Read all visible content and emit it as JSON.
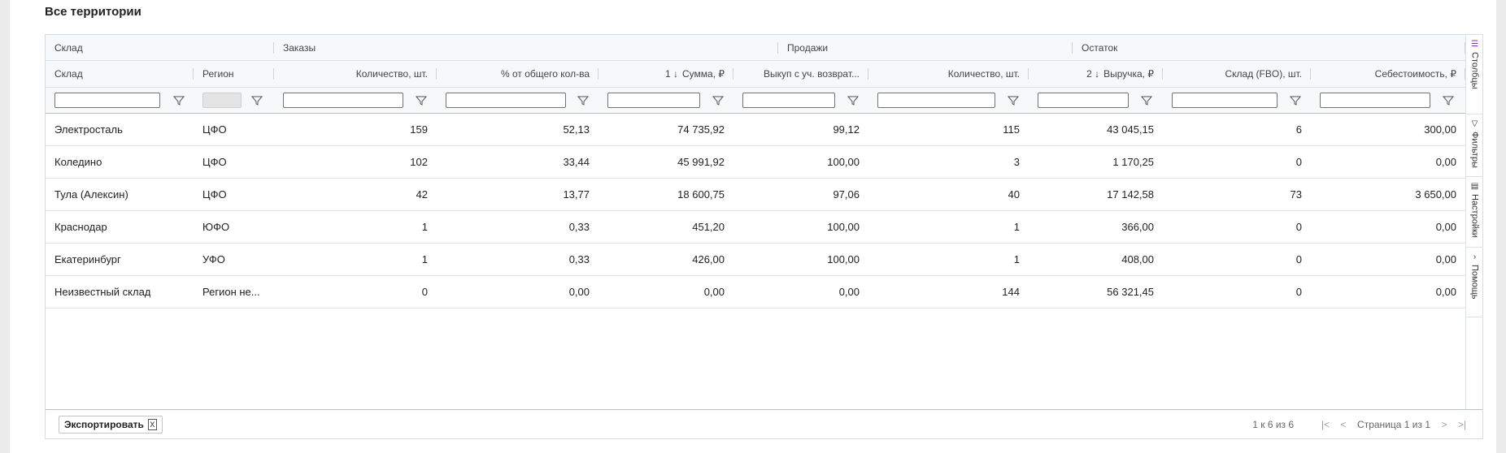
{
  "section": {
    "title": "Все территории"
  },
  "groups": [
    {
      "label": "Склад"
    },
    {
      "label": "Заказы"
    },
    {
      "label": "Продажи"
    },
    {
      "label": "Остаток"
    }
  ],
  "columns": [
    {
      "label": "Склад",
      "sort": ""
    },
    {
      "label": "Регион",
      "sort": ""
    },
    {
      "label": "Количество, шт.",
      "sort": ""
    },
    {
      "label": "% от общего кол-ва",
      "sort": ""
    },
    {
      "label": "Сумма, ₽",
      "sort": "1 ↓"
    },
    {
      "label": "Выкуп с уч. возврат...",
      "sort": ""
    },
    {
      "label": "Количество, шт.",
      "sort": ""
    },
    {
      "label": "Выручка, ₽",
      "sort": "2 ↓"
    },
    {
      "label": "Склад (FBO), шт.",
      "sort": ""
    },
    {
      "label": "Себестоимость, ₽",
      "sort": ""
    }
  ],
  "rows": [
    [
      "Электросталь",
      "ЦФО",
      "159",
      "52,13",
      "74 735,92",
      "99,12",
      "115",
      "43 045,15",
      "6",
      "300,00"
    ],
    [
      "Коледино",
      "ЦФО",
      "102",
      "33,44",
      "45 991,92",
      "100,00",
      "3",
      "1 170,25",
      "0",
      "0,00"
    ],
    [
      "Тула (Алексин)",
      "ЦФО",
      "42",
      "13,77",
      "18 600,75",
      "97,06",
      "40",
      "17 142,58",
      "73",
      "3 650,00"
    ],
    [
      "Краснодар",
      "ЮФО",
      "1",
      "0,33",
      "451,20",
      "100,00",
      "1",
      "366,00",
      "0",
      "0,00"
    ],
    [
      "Екатеринбург",
      "УФО",
      "1",
      "0,33",
      "426,00",
      "100,00",
      "1",
      "408,00",
      "0",
      "0,00"
    ],
    [
      "Неизвестный склад",
      "Регион не...",
      "0",
      "0,00",
      "0,00",
      "0,00",
      "144",
      "56 321,45",
      "0",
      "0,00"
    ]
  ],
  "footer": {
    "export_label": "Экспортировать",
    "export_icon": "X",
    "summary": "1 к 6 из 6",
    "page_info": "Страница 1 из 1"
  },
  "side_panel": [
    {
      "label": "Столбцы",
      "icon": "columns-icon"
    },
    {
      "label": "Фильтры",
      "icon": "filter-icon"
    },
    {
      "label": "Настройки",
      "icon": "settings-icon"
    },
    {
      "label": "Помощь",
      "icon": "help-icon"
    }
  ],
  "colors": {
    "accent": "#8a2be2",
    "header_bg": "#f7f8f9",
    "border": "#dde2eb"
  }
}
